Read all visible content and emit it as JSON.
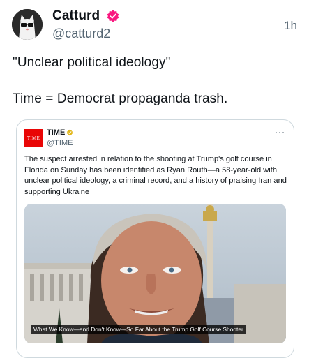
{
  "author": {
    "name": "Catturd",
    "handle": "@catturd2",
    "time": "1h",
    "avatar_icon": "cat-avatar-icon",
    "verified_icon": "verified-badge-icon",
    "verified_color": "#f91880"
  },
  "tweet": {
    "line1": "\"Unclear political ideology\"",
    "line2": "Time = Democrat propaganda trash."
  },
  "quoted": {
    "logo_text": "TIME",
    "name": "TIME",
    "handle": "@TIME",
    "badge_color": "#e2b719",
    "more": "···",
    "text": "The suspect arrested in relation to the shooting at Trump's golf course in Florida on Sunday has been identified as Ryan Routh—a 58-year-old with unclear political ideology, a criminal record, and a history of praising Iran and supporting Ukraine",
    "caption": "What We Know—and Don't Know—So Far About the Trump Golf Course Shooter"
  }
}
